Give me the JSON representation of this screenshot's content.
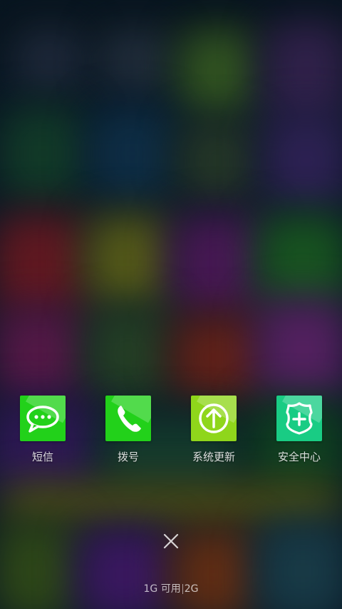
{
  "recent_apps": [
    {
      "label": "短信",
      "icon": "message-icon",
      "color": "#22d11a"
    },
    {
      "label": "拨号",
      "icon": "phone-icon",
      "color": "#22d11a"
    },
    {
      "label": "系统更新",
      "icon": "update-arrow-icon",
      "color": "#8fd61b"
    },
    {
      "label": "安全中心",
      "icon": "shield-plus-icon",
      "color": "#19cc84"
    }
  ],
  "close_button": {
    "icon": "close-icon"
  },
  "memory": {
    "available_text": "1G 可用",
    "total_text": "2G"
  }
}
